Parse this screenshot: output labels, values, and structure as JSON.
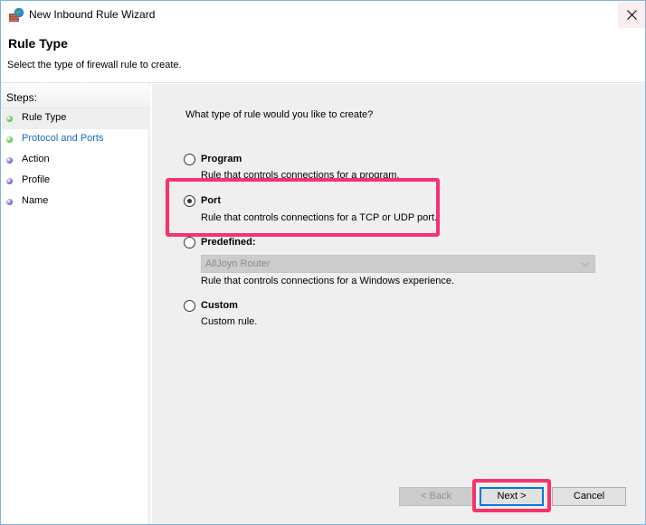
{
  "window": {
    "title": "New Inbound Rule Wizard",
    "close_icon": "close-icon"
  },
  "header": {
    "title": "Rule Type",
    "subtitle": "Select the type of firewall rule to create."
  },
  "steps": {
    "title": "Steps:",
    "items": [
      {
        "label": "Rule Type",
        "state": "current",
        "dot_color": "#5cc04a",
        "text_color": "#000000"
      },
      {
        "label": "Protocol and Ports",
        "state": "link",
        "dot_color": "#5cc04a",
        "text_color": "#1a6ac2"
      },
      {
        "label": "Action",
        "state": "pending",
        "dot_color": "#6a67cf",
        "text_color": "#000000"
      },
      {
        "label": "Profile",
        "state": "pending",
        "dot_color": "#6a67cf",
        "text_color": "#000000"
      },
      {
        "label": "Name",
        "state": "pending",
        "dot_color": "#6a67cf",
        "text_color": "#000000"
      }
    ]
  },
  "content": {
    "question": "What type of rule would you like to create?",
    "options": [
      {
        "label": "Program",
        "description": "Rule that controls connections for a program.",
        "selected": false
      },
      {
        "label": "Port",
        "description": "Rule that controls connections for a TCP or UDP port.",
        "selected": true
      },
      {
        "label": "Predefined:",
        "description": "Rule that controls connections for a Windows experience.",
        "selected": false
      },
      {
        "label": "Custom",
        "description": "Custom rule.",
        "selected": false
      }
    ],
    "predefined_dropdown": {
      "value": "AllJoyn Router",
      "enabled": false
    }
  },
  "buttons": {
    "back": "< Back",
    "next": "Next >",
    "cancel": "Cancel"
  },
  "colors": {
    "highlight": "#f7326c",
    "default_button_border": "#0078d7"
  }
}
